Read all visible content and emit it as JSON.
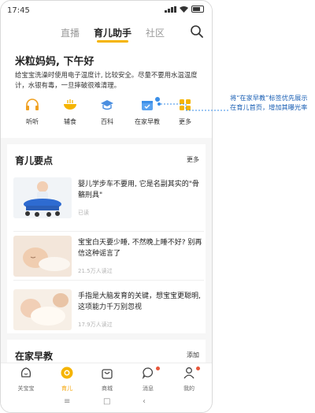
{
  "status_bar": {
    "time": "17:45"
  },
  "top_nav": {
    "tabs": [
      {
        "label": "直播",
        "active": false
      },
      {
        "label": "育儿助手",
        "active": true
      },
      {
        "label": "社区",
        "active": false
      }
    ]
  },
  "header": {
    "greeting": "米粒妈妈, 下午好",
    "tip": "给宝宝洗澡时使用电子温度计, 比较安全。尽量不要用水温温度计，水银有毒，一旦摔破很难清理。",
    "quick_actions": [
      {
        "label": "听听",
        "icon": "headphones-icon"
      },
      {
        "label": "辅食",
        "icon": "bowl-icon"
      },
      {
        "label": "百科",
        "icon": "graduation-cap-icon"
      },
      {
        "label": "在家早教",
        "icon": "calendar-check-icon"
      },
      {
        "label": "更多",
        "icon": "grid-icon"
      }
    ]
  },
  "parenting": {
    "title": "育儿要点",
    "more": "更多",
    "articles": [
      {
        "title": "婴儿学步车不要用, 它是名副其实的\"骨骼刑具\"",
        "meta": "已读"
      },
      {
        "title": "宝宝白天要少睡, 不然晚上睡不好? 别再信这种谣言了",
        "meta": "21.5万人读过"
      },
      {
        "title": "手指是大脑发育的关键，想宝宝更聪明, 这项能力千万别忽视",
        "meta": "17.9万人读过"
      }
    ]
  },
  "early_edu": {
    "title": "在家早教",
    "action": "添加"
  },
  "bottom_nav": [
    {
      "label": "关宝宝",
      "icon": "baby-face-icon",
      "active": false
    },
    {
      "label": "育儿",
      "icon": "smile-circle-icon",
      "active": true
    },
    {
      "label": "商城",
      "icon": "shopping-bag-icon",
      "active": false
    },
    {
      "label": "消息",
      "icon": "chat-bubble-icon",
      "active": false
    },
    {
      "label": "我的",
      "icon": "person-icon",
      "active": false
    }
  ],
  "annotation": {
    "text": "将“在家早教”标签优先展示在育儿首页，增加其曝光率"
  },
  "colors": {
    "accent": "#f5b400",
    "annotation": "#1a5fb4",
    "badge": "#3b8fe8",
    "notification": "#e8573b"
  }
}
